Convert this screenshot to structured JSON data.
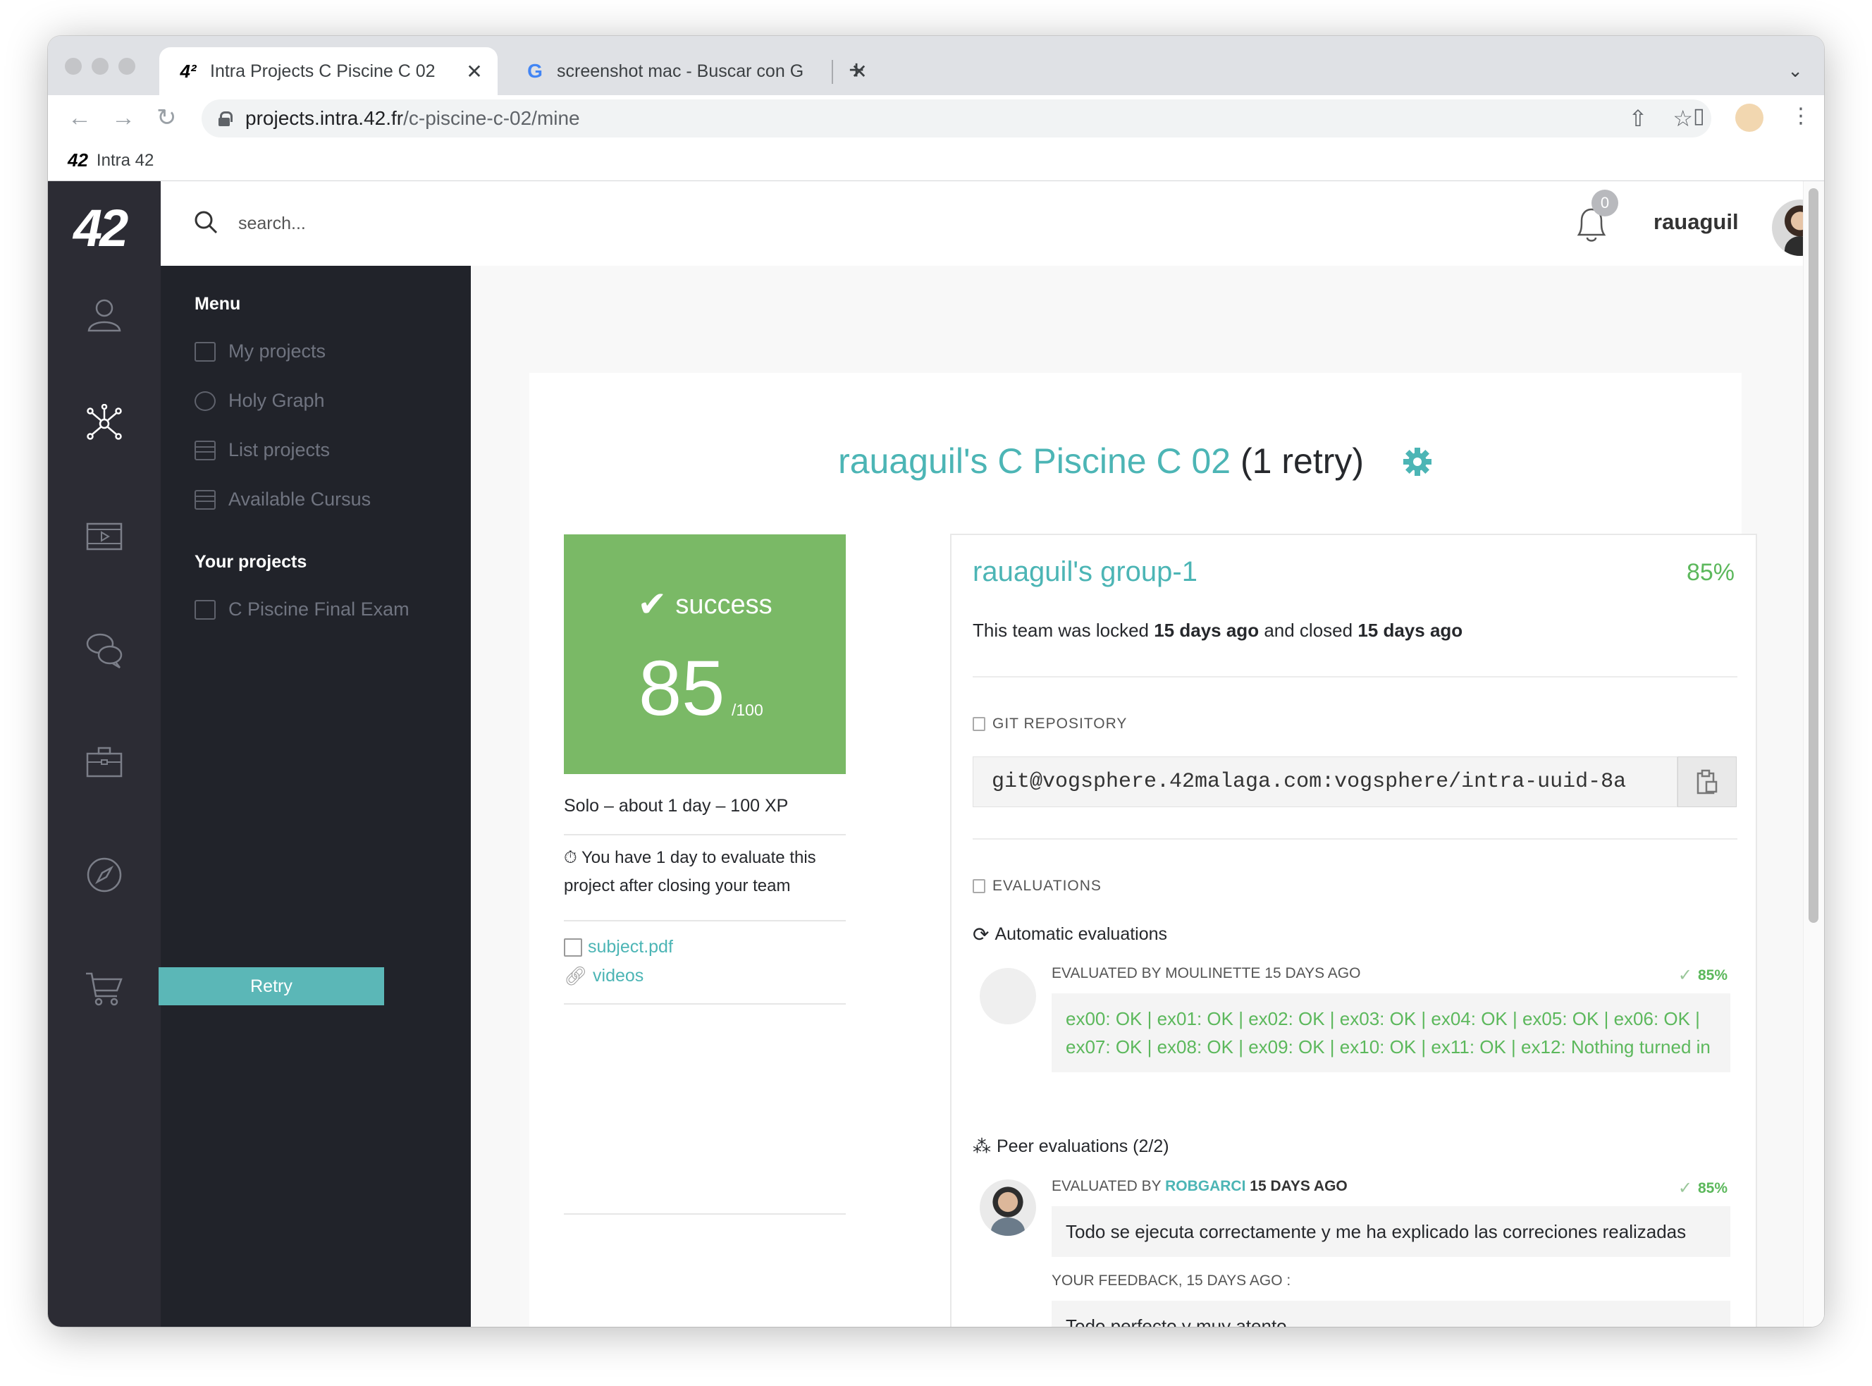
{
  "browser": {
    "tabs": [
      {
        "title": "Intra Projects C Piscine C 02",
        "favicon": "42-logo",
        "active": true
      },
      {
        "title": "screenshot mac - Buscar con G",
        "favicon": "google-icon",
        "active": false
      }
    ],
    "url_domain": "projects.intra.42.fr",
    "url_path": "/c-piscine-c-02/mine",
    "bookmark": {
      "logo": "42",
      "label": "Intra 42"
    }
  },
  "app": {
    "logo": "42",
    "search_placeholder": "search...",
    "notifications_count": "0",
    "username": "rauaguil"
  },
  "menu": {
    "menu_title": "Menu",
    "items": [
      {
        "label": "My projects",
        "icon": "briefcase-icon"
      },
      {
        "label": "Holy Graph",
        "icon": "globe-icon"
      },
      {
        "label": "List projects",
        "icon": "list-icon"
      },
      {
        "label": "Available Cursus",
        "icon": "list-icon"
      }
    ],
    "your_projects_title": "Your projects",
    "your_projects": [
      {
        "label": "C Piscine Final Exam",
        "icon": "exam-icon"
      }
    ]
  },
  "project": {
    "title": "rauaguil's C Piscine C 02",
    "retry_suffix": "(1 retry)",
    "status": "success",
    "score": "85",
    "score_max": "/100",
    "meta": "Solo – about 1 day – 100 XP",
    "evaluate_note": "You have 1 day to evaluate this project after closing your team",
    "links": [
      {
        "label": "subject.pdf",
        "icon": "document-icon"
      },
      {
        "label": "videos",
        "icon": "paperclip-icon"
      }
    ],
    "retry_label": "Retry"
  },
  "team": {
    "name": "rauaguil's group-1",
    "percent": "85%",
    "locked_prefix": "This team was locked",
    "locked_when": "15 days ago",
    "closed_prefix": "and closed",
    "closed_when": "15 days ago",
    "git_label": "GIT REPOSITORY",
    "git_url": "git@vogsphere.42malaga.com:vogsphere/intra-uuid-8a",
    "evaluations_label": "EVALUATIONS",
    "auto_title": "Automatic evaluations",
    "auto_eval": {
      "by_prefix": "EVALUATED BY",
      "by_name": "MOULINETTE",
      "when": "15 DAYS AGO",
      "percent": "85%",
      "result": "ex00: OK | ex01: OK | ex02: OK | ex03: OK | ex04: OK | ex05: OK | ex06: OK | ex07: OK | ex08: OK | ex09: OK | ex10: OK | ex11: OK | ex12: Nothing turned in"
    },
    "peer_title": "Peer evaluations (2/2)",
    "peer_eval": {
      "by_prefix": "EVALUATED BY",
      "by_name": "ROBGARCI",
      "when": "15 DAYS AGO",
      "percent": "85%",
      "comment": "Todo se ejecuta correctamente y me ha explicado las correciones realizadas",
      "feedback_label": "YOUR FEEDBACK,  15 DAYS AGO :",
      "feedback": "Todo perfecto y muy atento"
    }
  },
  "colors": {
    "teal": "#4cb5b5",
    "success_green": "#7ab966",
    "ok_green": "#5cb85c",
    "sidebar_dark": "#2c2c34",
    "menu_dark": "#21232a"
  }
}
